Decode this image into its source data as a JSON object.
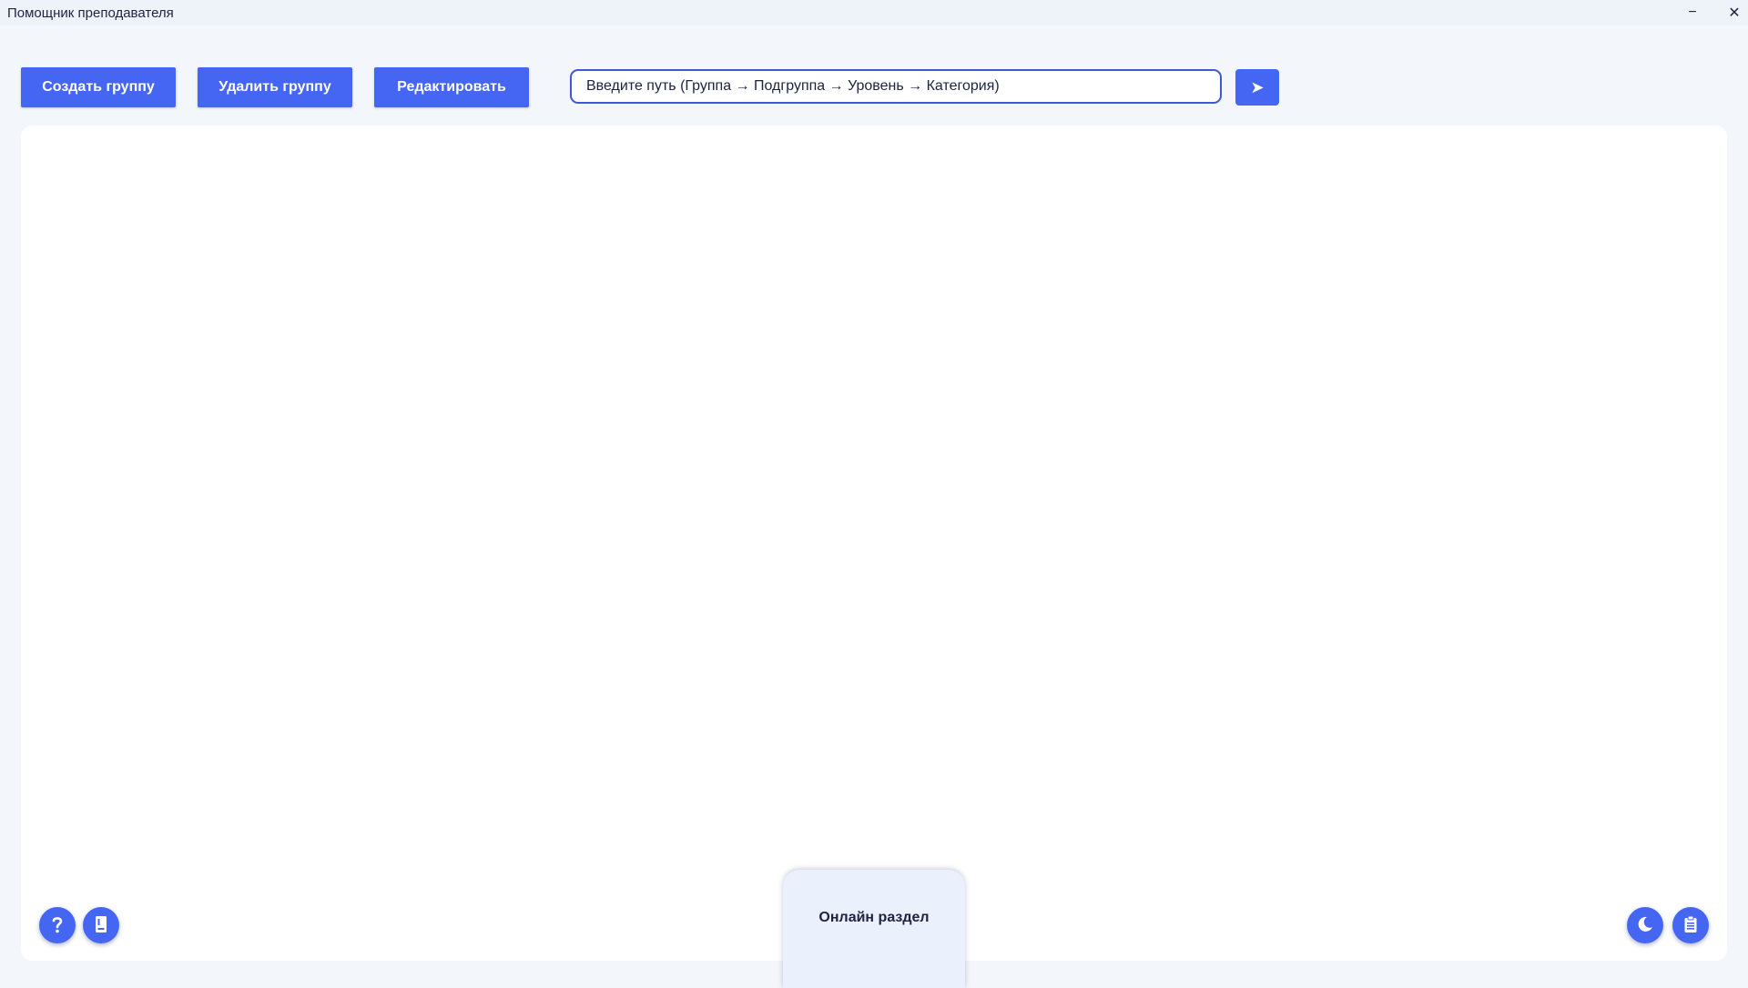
{
  "window": {
    "title": "Помощник преподавателя",
    "minimize_glyph": "−",
    "close_glyph": "✕"
  },
  "toolbar": {
    "create_label": "Создать группу",
    "delete_label": "Удалить группу",
    "edit_label": "Редактировать"
  },
  "path_input": {
    "placeholder": "Введите путь (Группа → Подгруппа → Уровень → Категория)",
    "value": ""
  },
  "send_button": {
    "icon": "send-arrow-icon",
    "glyph": "➤"
  },
  "corner_buttons": {
    "help_icon": "help-icon",
    "book_icon": "book-icon",
    "theme_icon": "moon-icon",
    "clipboard_icon": "clipboard-icon"
  },
  "online_section": {
    "label": "Онлайн раздел"
  },
  "colors": {
    "accent": "#4566f2",
    "input_border": "#3f56d8",
    "background": "#f3f6fb",
    "panel": "#ffffff",
    "card": "#eaf0fc",
    "text": "#1c2440"
  }
}
